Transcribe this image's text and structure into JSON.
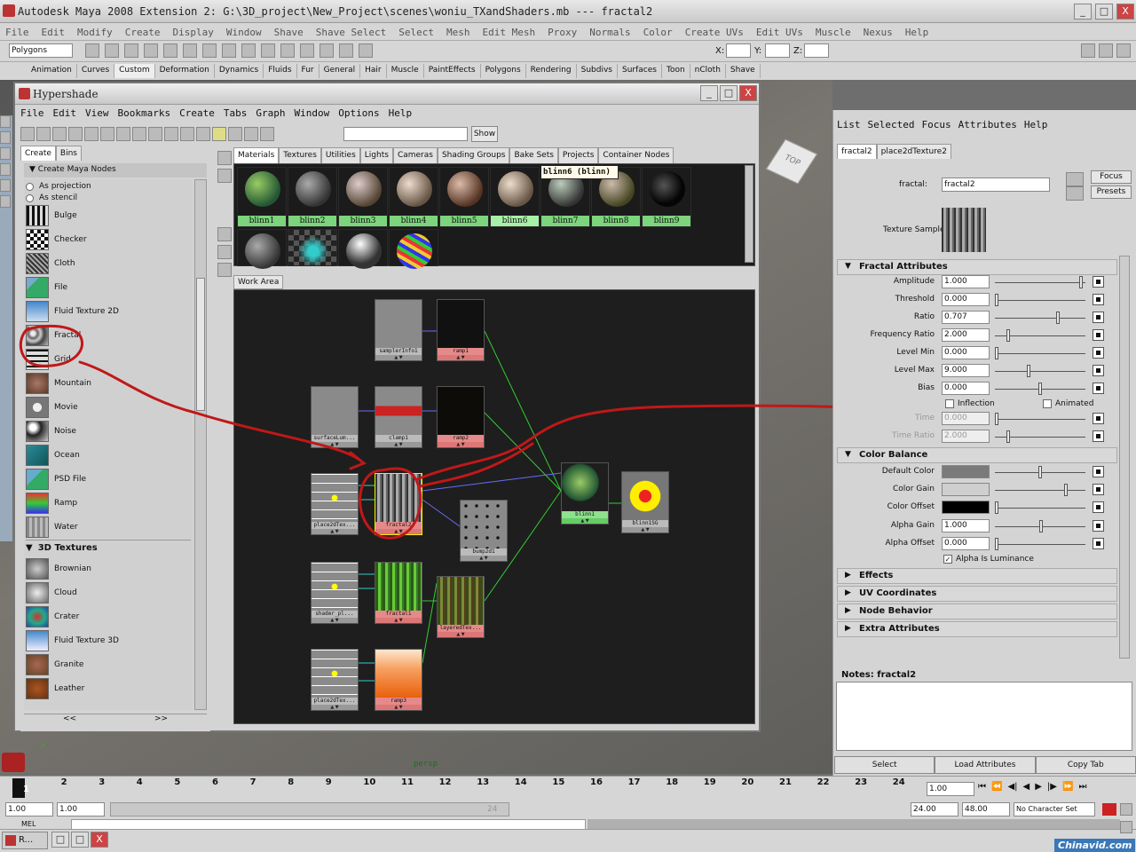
{
  "window": {
    "title": "Autodesk Maya 2008 Extension 2: G:\\3D_project\\New_Project\\scenes\\woniu_TXandShaders.mb   ---   fractal2",
    "minimize": "_",
    "maximize": "□",
    "close": "X"
  },
  "main_menu": [
    "File",
    "Edit",
    "Modify",
    "Create",
    "Display",
    "Window",
    "Shave",
    "Shave Select",
    "Select",
    "Mesh",
    "Edit Mesh",
    "Proxy",
    "Normals",
    "Color",
    "Create UVs",
    "Edit UVs",
    "Muscle",
    "Nexus",
    "Help"
  ],
  "status_line": {
    "mode": "Polygons",
    "x_label": "X:",
    "y_label": "Y:",
    "z_label": "Z:"
  },
  "shelf_tabs": [
    "Animation",
    "Curves",
    "Custom",
    "Deformation",
    "Dynamics",
    "Fluids",
    "Fur",
    "General",
    "Hair",
    "Muscle",
    "PaintEffects",
    "Polygons",
    "Rendering",
    "Subdivs",
    "Surfaces",
    "Toon",
    "nCloth",
    "Shave"
  ],
  "shelf_active": "Custom",
  "hypershade": {
    "title": "Hypershade",
    "menu": [
      "File",
      "Edit",
      "View",
      "Bookmarks",
      "Create",
      "Tabs",
      "Graph",
      "Window",
      "Options",
      "Help"
    ],
    "show_button": "Show",
    "left_tabs": [
      "Create",
      "Bins"
    ],
    "create_section": "Create Maya Nodes",
    "radio_options": [
      "As projection",
      "As stencil"
    ],
    "textures_2d": [
      "Bulge",
      "Checker",
      "Cloth",
      "File",
      "Fluid Texture 2D",
      "Fractal",
      "Grid",
      "Mountain",
      "Movie",
      "Noise",
      "Ocean",
      "PSD File",
      "Ramp",
      "Water"
    ],
    "textures_3d_section": "3D Textures",
    "textures_3d": [
      "Brownian",
      "Cloud",
      "Crater",
      "Fluid Texture 3D",
      "Granite",
      "Leather"
    ],
    "nav_prev": "<<",
    "nav_next": ">>",
    "swatch_tabs": [
      "Materials",
      "Textures",
      "Utilities",
      "Lights",
      "Cameras",
      "Shading Groups",
      "Bake Sets",
      "Projects",
      "Container Nodes"
    ],
    "active_swatch_tab": "Materials",
    "materials": [
      "blinn1",
      "blinn2",
      "blinn3",
      "blinn4",
      "blinn5",
      "blinn6",
      "blinn7",
      "blinn8",
      "blinn9"
    ],
    "tooltip": "blinn6 (blinn)",
    "work_area_tab": "Work Area",
    "nodes": [
      "samplerInfo1",
      "ramp1",
      "surfaceLum...",
      "clamp1",
      "ramp2",
      "place2dTex...",
      "fractal2",
      "bump2d1",
      "blinn1",
      "blinn1SG",
      "shader_pl...",
      "fractal1",
      "layeredTex...",
      "place2dTex...",
      "ramp3"
    ]
  },
  "viewport": {
    "label": "persp",
    "cube_label": "TOP"
  },
  "attribute_editor": {
    "menu": [
      "List",
      "Selected",
      "Focus",
      "Attributes",
      "Help"
    ],
    "tabs": [
      "fractal2",
      "place2dTexture2"
    ],
    "node_label": "fractal:",
    "node_name": "fractal2",
    "focus_button": "Focus",
    "presets_button": "Presets",
    "texture_sample_label": "Texture Sample",
    "fractal_section": "Fractal Attributes",
    "fractal_attrs": [
      {
        "label": "Amplitude",
        "value": "1.000",
        "level": 0.97
      },
      {
        "label": "Threshold",
        "value": "0.000",
        "level": 0.0
      },
      {
        "label": "Ratio",
        "value": "0.707",
        "level": 0.7
      },
      {
        "label": "Frequency Ratio",
        "value": "2.000",
        "level": 0.13
      },
      {
        "label": "Level Min",
        "value": "0.000",
        "level": 0.0
      },
      {
        "label": "Level Max",
        "value": "9.000",
        "level": 0.37
      },
      {
        "label": "Bias",
        "value": "0.000",
        "level": 0.5
      }
    ],
    "inflection_label": "Inflection",
    "animated_label": "Animated",
    "time_label": "Time",
    "time_value": "0.000",
    "time_ratio_label": "Time Ratio",
    "time_ratio_value": "2.000",
    "color_balance_section": "Color Balance",
    "color_attrs": [
      {
        "label": "Default Color",
        "color": "#7a7a7a",
        "level": 0.5
      },
      {
        "label": "Color Gain",
        "color": "#cfcfcf",
        "level": 0.8
      },
      {
        "label": "Color Offset",
        "color": "#000000",
        "level": 0.0
      }
    ],
    "alpha_gain_label": "Alpha Gain",
    "alpha_gain_value": "1.000",
    "alpha_offset_label": "Alpha Offset",
    "alpha_offset_value": "0.000",
    "alpha_is_luminance_label": "Alpha Is Luminance",
    "collapsed_sections": [
      "Effects",
      "UV Coordinates",
      "Node Behavior",
      "Extra Attributes"
    ],
    "notes_label": "Notes:  fractal2",
    "bottom_buttons": [
      "Select",
      "Load Attributes",
      "Copy Tab"
    ]
  },
  "timeline": {
    "frames": [
      "1",
      "2",
      "3",
      "4",
      "5",
      "6",
      "7",
      "8",
      "9",
      "10",
      "11",
      "12",
      "13",
      "14",
      "15",
      "16",
      "17",
      "18",
      "19",
      "20",
      "21",
      "22",
      "23",
      "24"
    ],
    "current_frame": "1.00",
    "range_start": "1.00",
    "range_start2": "1.00",
    "range_end_inner": "24",
    "range_end": "24.00",
    "range_end2": "48.00",
    "character_set": "No Character Set",
    "mel_label": "MEL"
  },
  "taskbar": {
    "app_label": "R...",
    "watermark": "Chinavid.com"
  },
  "colors": {
    "annotation_red": "#c01818",
    "swatch_label_green": "#7cd47c",
    "node_label_red": "#e58a8a",
    "node_label_green": "#8fe08f"
  }
}
